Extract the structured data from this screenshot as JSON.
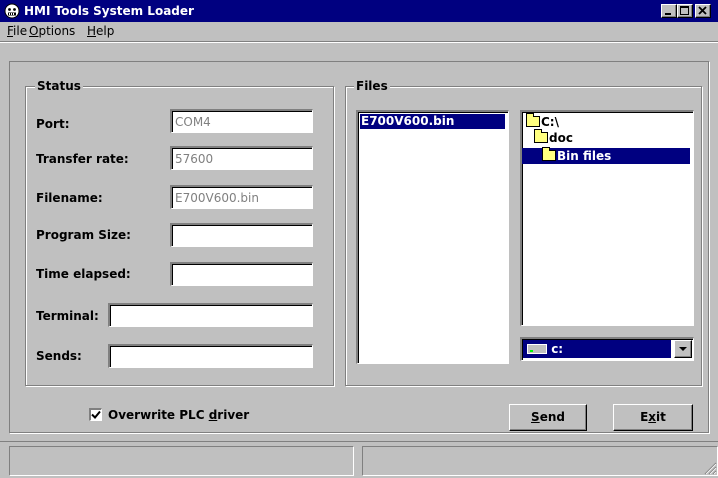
{
  "window": {
    "title": "HMI Tools System Loader",
    "title_bar_color": "#000080",
    "background": "#c0c0c0"
  },
  "menu": {
    "file": {
      "accel": "F",
      "rest": "ile"
    },
    "options": {
      "accel": "O",
      "rest": "ptions"
    },
    "help": {
      "accel": "H",
      "rest": "elp"
    }
  },
  "status": {
    "title": "Status",
    "port_label": "Port:",
    "port_value": "COM4",
    "transfer_rate_label": "Transfer rate:",
    "transfer_rate_value": "57600",
    "filename_label": "Filename:",
    "filename_value": "E700V600.bin",
    "program_size_label": "Program Size:",
    "program_size_value": "",
    "time_elapsed_label": "Time elapsed:",
    "time_elapsed_value": "",
    "terminal_label": "Terminal:",
    "terminal_value": "",
    "sends_label": "Sends:",
    "sends_value": ""
  },
  "files": {
    "title": "Files",
    "file_list": [
      "E700V600.bin"
    ],
    "dir_tree": [
      "C:\\",
      "doc",
      "Bin files"
    ],
    "drive": "c:"
  },
  "options": {
    "overwrite_checked": true,
    "overwrite_before": "Overwrite PLC ",
    "overwrite_accel": "d",
    "overwrite_after": "river"
  },
  "buttons": {
    "send": {
      "accel": "S",
      "rest": "end"
    },
    "exit": {
      "pre": "E",
      "accel": "x",
      "rest": "it"
    }
  },
  "icons": {
    "app": "hmi-face-icon",
    "minimize": "minimize-icon",
    "maximize": "maximize-icon",
    "close": "close-icon",
    "checkbox": "checkmark-icon",
    "drive": "hard-drive-icon",
    "dropdown": "triangle-down-icon",
    "folder": "folder-icon",
    "grip": "size-grip-icon"
  }
}
